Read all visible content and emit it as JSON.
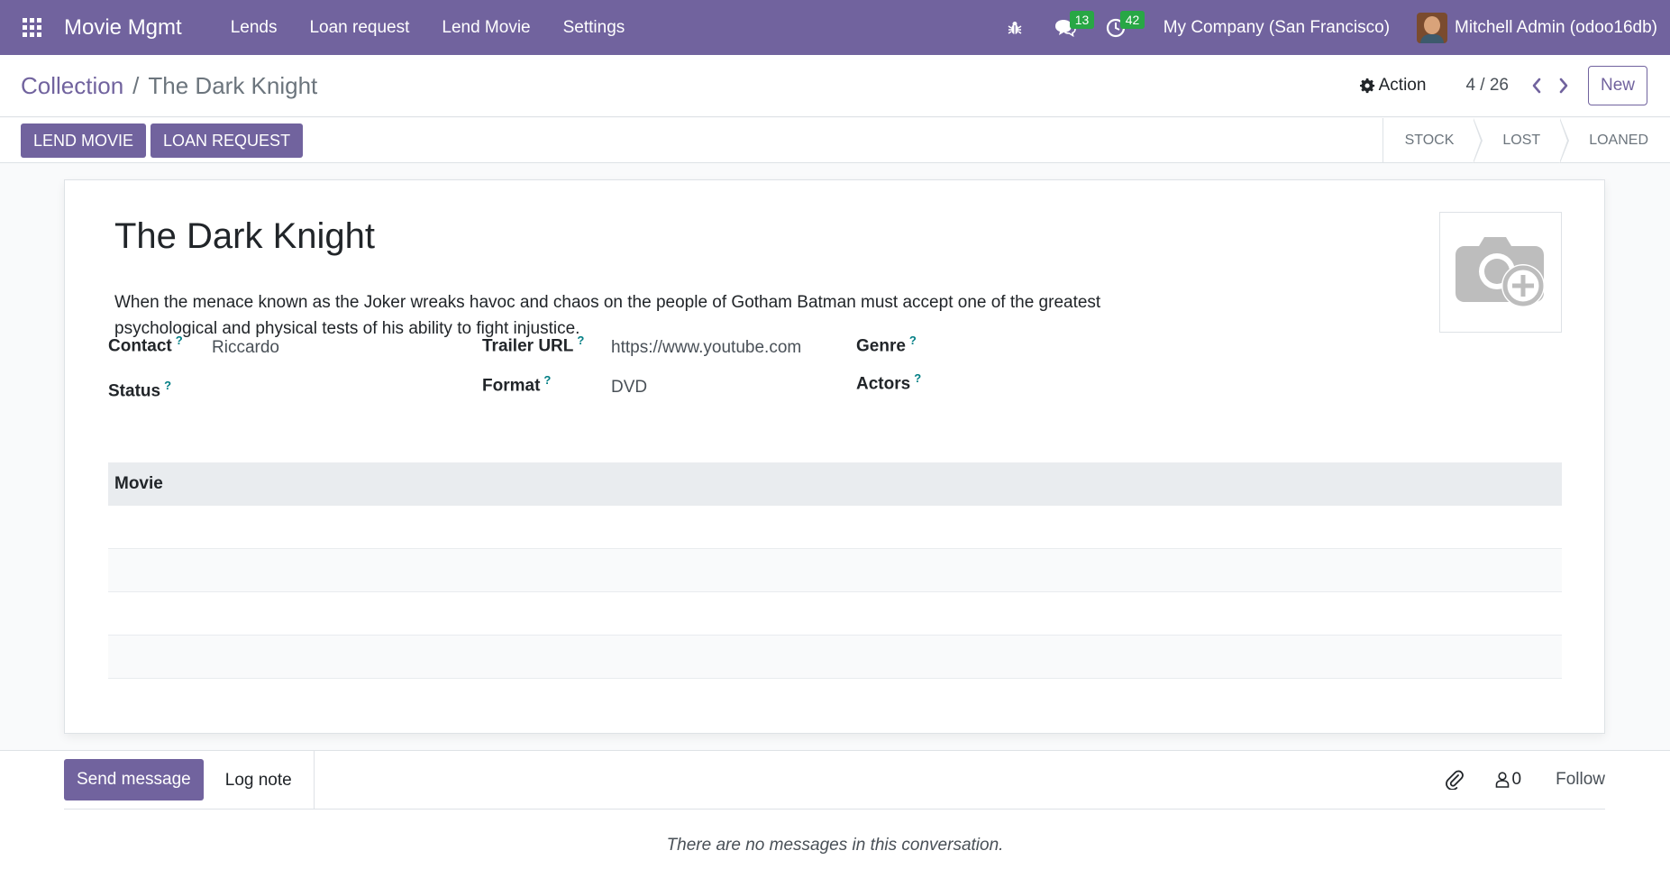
{
  "navbar": {
    "app_name": "Movie Mgmt",
    "menu": [
      "Lends",
      "Loan request",
      "Lend Movie",
      "Settings"
    ],
    "messages_count": "13",
    "activities_count": "42",
    "company": "My Company (San Francisco)",
    "user": "Mitchell Admin (odoo16db)",
    "colors": {
      "primary": "#71639e",
      "badge": "#28a745"
    }
  },
  "breadcrumb": {
    "parent": "Collection",
    "separator": "/",
    "current": "The Dark Knight"
  },
  "control": {
    "action_label": "Action",
    "pager": "4 / 26",
    "new_label": "New"
  },
  "header": {
    "buttons": [
      "LEND MOVIE",
      "LOAN REQUEST"
    ],
    "stages": [
      "STOCK",
      "LOST",
      "LOANED"
    ]
  },
  "form": {
    "title": "The Dark Knight",
    "description": "When the menace known as the Joker wreaks havoc and chaos on the people of Gotham Batman must accept one of the greatest psychological and physical tests of his ability to fight injustice.",
    "help_mark": "?",
    "fields": {
      "contact": {
        "label": "Contact",
        "value": "Riccardo"
      },
      "status": {
        "label": "Status",
        "value": ""
      },
      "trailer_url": {
        "label": "Trailer URL",
        "value": "https://www.youtube.com"
      },
      "format": {
        "label": "Format",
        "value": "DVD"
      },
      "genre": {
        "label": "Genre",
        "value": ""
      },
      "actors": {
        "label": "Actors",
        "value": ""
      }
    },
    "table": {
      "header": "Movie"
    }
  },
  "chatter": {
    "send_label": "Send message",
    "log_label": "Log note",
    "followers_count": "0",
    "follow_label": "Follow",
    "empty_text": "There are no messages in this conversation."
  }
}
